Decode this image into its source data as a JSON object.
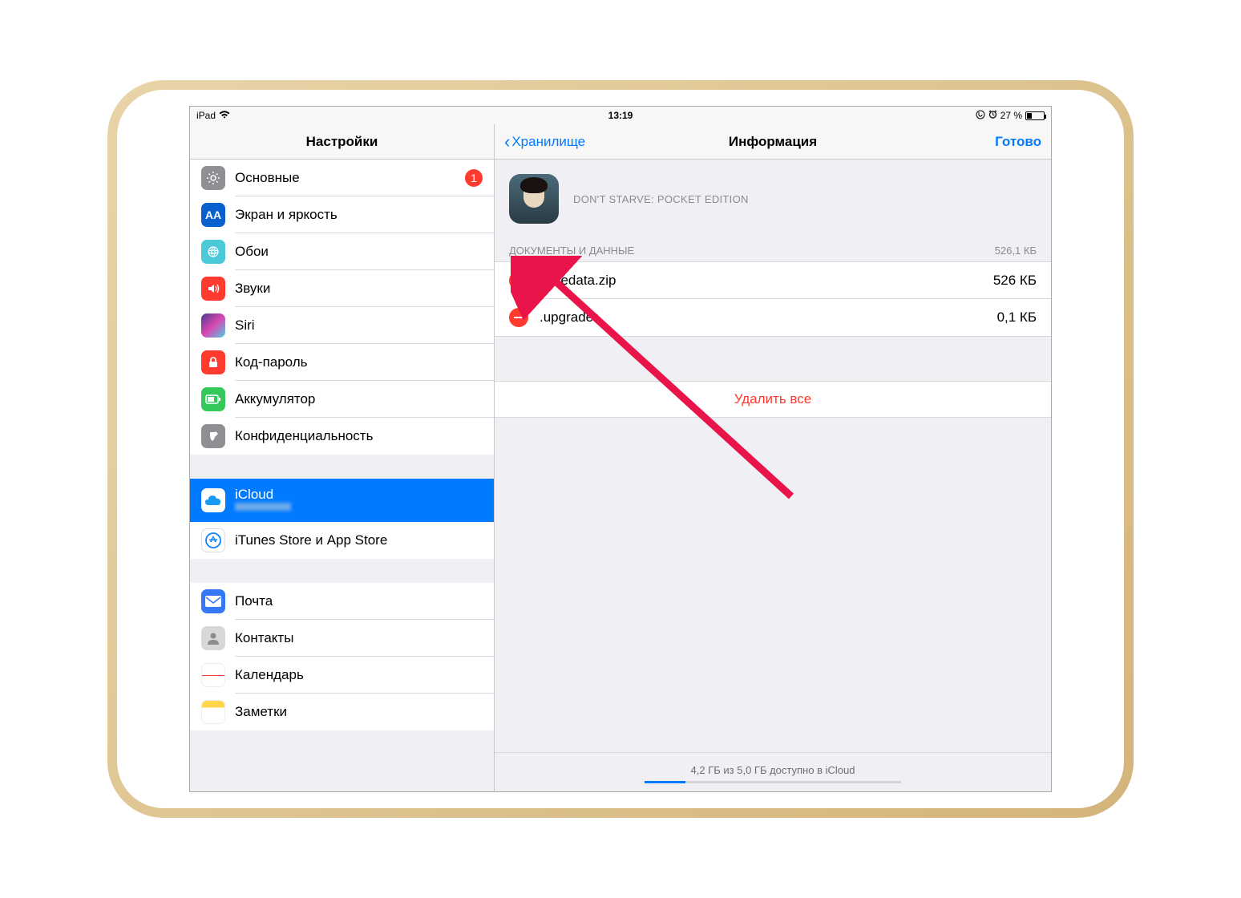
{
  "status": {
    "device": "iPad",
    "time": "13:19",
    "battery_percent": "27 %"
  },
  "sidebar": {
    "title": "Настройки",
    "groups": [
      {
        "items": [
          {
            "icon": "general",
            "label": "Основные",
            "badge": "1"
          },
          {
            "icon": "display",
            "label": "Экран и яркость"
          },
          {
            "icon": "wallpaper",
            "label": "Обои"
          },
          {
            "icon": "sounds",
            "label": "Звуки"
          },
          {
            "icon": "siri",
            "label": "Siri"
          },
          {
            "icon": "passcode",
            "label": "Код-пароль"
          },
          {
            "icon": "battery",
            "label": "Аккумулятор"
          },
          {
            "icon": "privacy",
            "label": "Конфиденциальность"
          }
        ]
      },
      {
        "items": [
          {
            "icon": "icloud",
            "label": "iCloud",
            "selected": true,
            "sub": ""
          },
          {
            "icon": "store",
            "label": "iTunes Store и App Store"
          }
        ]
      },
      {
        "items": [
          {
            "icon": "mail",
            "label": "Почта"
          },
          {
            "icon": "contacts",
            "label": "Контакты"
          },
          {
            "icon": "calendar",
            "label": "Календарь"
          },
          {
            "icon": "notes",
            "label": "Заметки"
          }
        ]
      }
    ]
  },
  "detail": {
    "back_label": "Хранилище",
    "title": "Информация",
    "done_label": "Готово",
    "app_name": "DON'T STARVE: POCKET EDITION",
    "section_label": "ДОКУМЕНТЫ И ДАННЫЕ",
    "section_size": "526,1 КБ",
    "documents": [
      {
        "name": "savedata.zip",
        "size": "526 КБ"
      },
      {
        "name": ".upgrader",
        "size": "0,1 КБ"
      }
    ],
    "delete_all": "Удалить все",
    "footer_text": "4,2 ГБ из 5,0 ГБ доступно в iCloud"
  }
}
